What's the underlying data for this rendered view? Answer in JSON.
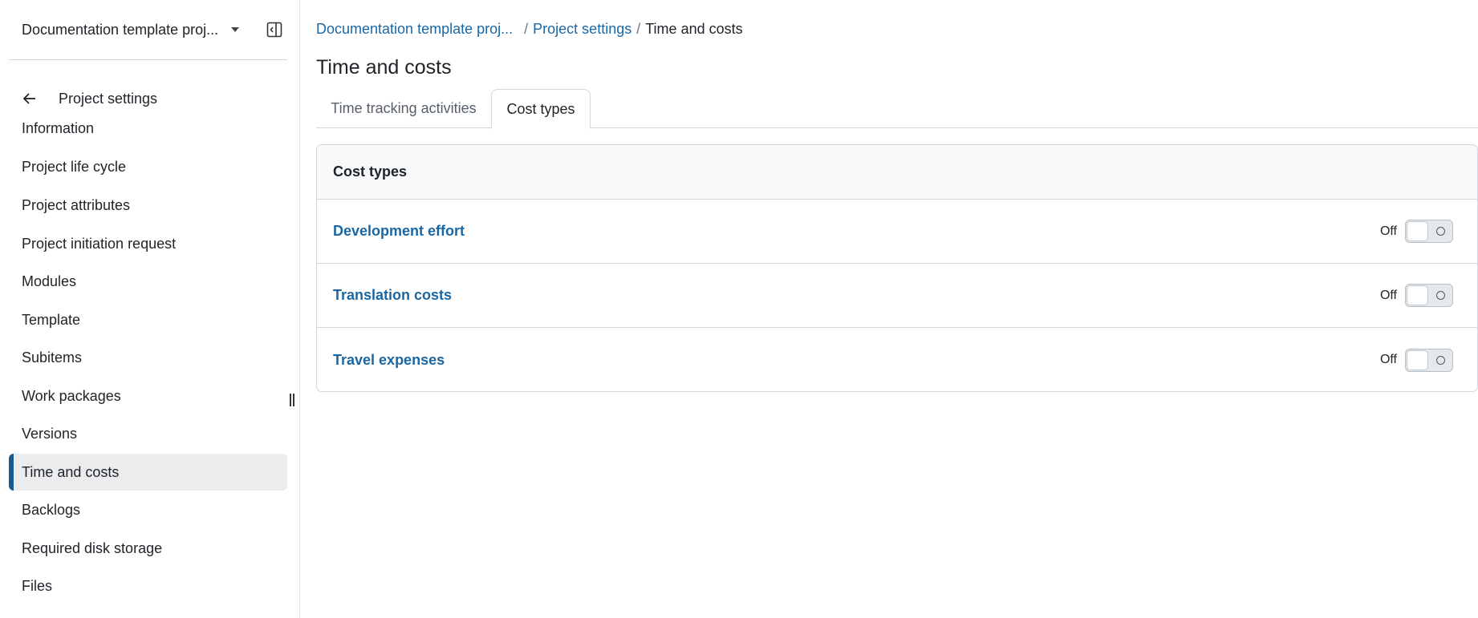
{
  "sidebar": {
    "project_name": "Documentation template proj...",
    "back_label": "Project settings",
    "items": [
      {
        "label": "Information"
      },
      {
        "label": "Project life cycle"
      },
      {
        "label": "Project attributes"
      },
      {
        "label": "Project initiation request"
      },
      {
        "label": "Modules"
      },
      {
        "label": "Template"
      },
      {
        "label": "Subitems"
      },
      {
        "label": "Work packages"
      },
      {
        "label": "Versions"
      },
      {
        "label": "Time and costs",
        "active": true
      },
      {
        "label": "Backlogs"
      },
      {
        "label": "Required disk storage"
      },
      {
        "label": "Files"
      }
    ]
  },
  "breadcrumb": {
    "items": [
      "Documentation template proj...",
      "Project settings",
      "Time and costs"
    ],
    "separator": "/"
  },
  "page_title": "Time and costs",
  "tabs": [
    {
      "label": "Time tracking activities",
      "selected": false
    },
    {
      "label": "Cost types",
      "selected": true
    }
  ],
  "cost_types": {
    "header": "Cost types",
    "rows": [
      {
        "name": "Development effort",
        "state_label": "Off"
      },
      {
        "name": "Translation costs",
        "state_label": "Off"
      },
      {
        "name": "Travel expenses",
        "state_label": "Off"
      }
    ]
  },
  "colors": {
    "accent": "#1a67a3",
    "active_indicator": "#1a5b8f",
    "active_bg": "#ebeced"
  },
  "icons": {
    "project_caret": "caret-down-icon",
    "collapse": "sidebar-collapse-icon",
    "back": "arrow-left-icon",
    "resize": "resize-handle-icon",
    "toggle_off": "toggle-off-icon"
  }
}
